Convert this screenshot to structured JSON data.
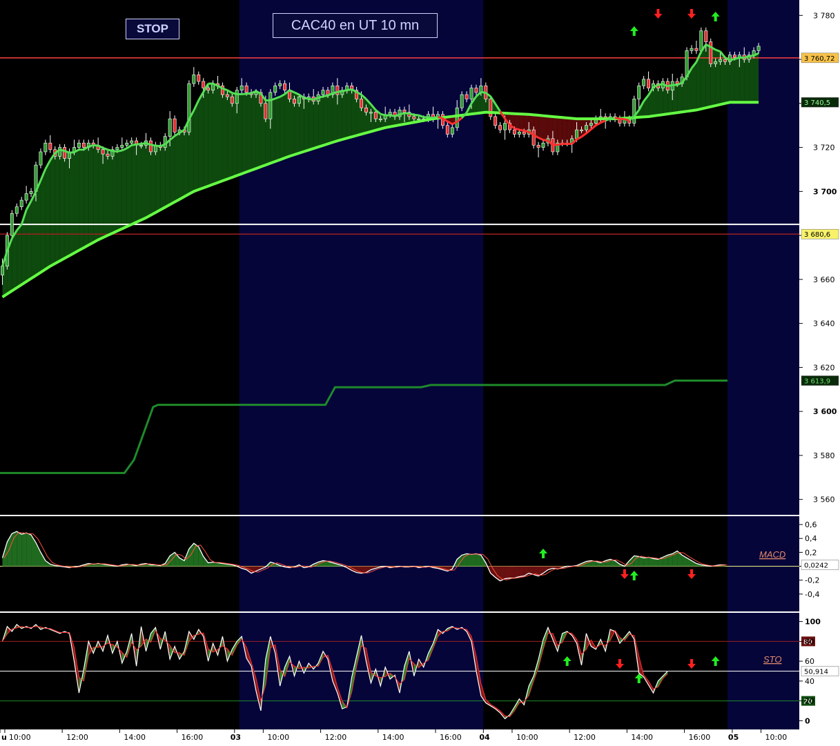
{
  "labels": {
    "stop": "STOP",
    "title": "CAC40 en UT 10 mn",
    "macd": "MACD",
    "sto": "STO"
  },
  "colors": {
    "background": "#000000",
    "session_band": "#05053a",
    "axis_bg": "#ffffff",
    "candle_up": "#2f9e2f",
    "candle_down": "#e23030",
    "ma_fast": "#55e055",
    "ma_slow": "#66ff44",
    "ma_red": "#ff3030",
    "fill_green": "#0e4a0e",
    "fill_red": "#5a0a0a",
    "stop_line": "#1f8a2a",
    "arrow_up": "#22ee22",
    "arrow_down": "#ff2020"
  },
  "chart_data": [
    {
      "type": "candlestick",
      "panel": "price",
      "y_ticks": [
        "3 780",
        "3 760",
        "3 740",
        "3 720",
        "3 700",
        "3 680",
        "3 660",
        "3 640",
        "3 620",
        "3 600",
        "3 580",
        "3 560"
      ],
      "y_ticks_bold": [
        "3 700",
        "3 600"
      ],
      "ylim": [
        3553,
        3787
      ],
      "x_ticks": [
        {
          "label": "u",
          "x": 0,
          "bold": true
        },
        {
          "label": "10:00",
          "x": 1
        },
        {
          "label": "12:00",
          "x": 13
        },
        {
          "label": "14:00",
          "x": 25
        },
        {
          "label": "16:00",
          "x": 37
        },
        {
          "label": "03",
          "x": 49,
          "bold": true
        },
        {
          "label": "10:00",
          "x": 55
        },
        {
          "label": "12:00",
          "x": 67
        },
        {
          "label": "14:00",
          "x": 79
        },
        {
          "label": "16:00",
          "x": 91
        },
        {
          "label": "04",
          "x": 101,
          "bold": true
        },
        {
          "label": "10:00",
          "x": 107
        },
        {
          "label": "12:00",
          "x": 119
        },
        {
          "label": "14:00",
          "x": 131
        },
        {
          "label": "16:00",
          "x": 143
        },
        {
          "label": "05",
          "x": 153,
          "bold": true
        },
        {
          "label": "10:00",
          "x": 159
        }
      ],
      "xlim": [
        0,
        167
      ],
      "sessions": [
        {
          "start": 0,
          "end": 50,
          "band": false
        },
        {
          "start": 50,
          "end": 101,
          "band": true
        },
        {
          "start": 101,
          "end": 152,
          "band": false
        },
        {
          "start": 152,
          "end": 167,
          "band": true
        }
      ],
      "closes": [
        3666,
        3680,
        3690,
        3693,
        3696,
        3699,
        3700,
        3712,
        3718,
        3722,
        3719,
        3716,
        3720,
        3715,
        3718,
        3720,
        3722,
        3720,
        3722,
        3721,
        3719,
        3717,
        3716,
        3719,
        3720,
        3721,
        3722,
        3723,
        3721,
        3721,
        3723,
        3718,
        3721,
        3720,
        3725,
        3733,
        3727,
        3728,
        3727,
        3749,
        3753,
        3750,
        3747,
        3746,
        3749,
        3748,
        3744,
        3743,
        3740,
        3746,
        3748,
        3745,
        3744,
        3745,
        3740,
        3733,
        3745,
        3748,
        3749,
        3746,
        3742,
        3740,
        3743,
        3742,
        3743,
        3741,
        3744,
        3746,
        3744,
        3748,
        3744,
        3746,
        3748,
        3746,
        3742,
        3738,
        3736,
        3736,
        3733,
        3733,
        3735,
        3736,
        3734,
        3737,
        3736,
        3734,
        3733,
        3733,
        3733,
        3735,
        3733,
        3735,
        3730,
        3726,
        3729,
        3738,
        3744,
        3742,
        3747,
        3745,
        3748,
        3742,
        3734,
        3730,
        3728,
        3731,
        3728,
        3726,
        3727,
        3726,
        3728,
        3721,
        3720,
        3722,
        3724,
        3718,
        3722,
        3722,
        3722,
        3724,
        3728,
        3728,
        3730,
        3731,
        3733,
        3734,
        3733,
        3734,
        3733,
        3731,
        3733,
        3731,
        3742,
        3748,
        3751,
        3747,
        3749,
        3747,
        3750,
        3746,
        3750,
        3749,
        3752,
        3764,
        3765,
        3764,
        3773,
        3768,
        3758,
        3759,
        3760,
        3759,
        3762,
        3761,
        3762,
        3760,
        3762,
        3764,
        3766
      ],
      "stop_level_label": "3 613,9",
      "stop_level": [
        {
          "x": 0,
          "y": 3572
        },
        {
          "x": 26,
          "y": 3572
        },
        {
          "x": 28,
          "y": 3578
        },
        {
          "x": 30,
          "y": 3590
        },
        {
          "x": 32,
          "y": 3602
        },
        {
          "x": 33,
          "y": 3603
        },
        {
          "x": 68,
          "y": 3603
        },
        {
          "x": 70,
          "y": 3611
        },
        {
          "x": 88,
          "y": 3611
        },
        {
          "x": 90,
          "y": 3612
        },
        {
          "x": 139,
          "y": 3612
        },
        {
          "x": 141,
          "y": 3614
        },
        {
          "x": 152,
          "y": 3614
        }
      ],
      "ma_slow_label": "3 740,5",
      "ma_slow": [
        {
          "x": 0,
          "y": 3652
        },
        {
          "x": 10,
          "y": 3666
        },
        {
          "x": 20,
          "y": 3678
        },
        {
          "x": 30,
          "y": 3688
        },
        {
          "x": 40,
          "y": 3700
        },
        {
          "x": 50,
          "y": 3708
        },
        {
          "x": 60,
          "y": 3716
        },
        {
          "x": 70,
          "y": 3723
        },
        {
          "x": 80,
          "y": 3729
        },
        {
          "x": 90,
          "y": 3733
        },
        {
          "x": 101,
          "y": 3736
        },
        {
          "x": 110,
          "y": 3735
        },
        {
          "x": 120,
          "y": 3733
        },
        {
          "x": 128,
          "y": 3733
        },
        {
          "x": 135,
          "y": 3734
        },
        {
          "x": 145,
          "y": 3737
        },
        {
          "x": 152,
          "y": 3740.5
        }
      ],
      "hlines": [
        {
          "label": "3 760,72",
          "y": 3760.7,
          "color": "#ff4040",
          "tag_bg": "#f7c24a",
          "tag_fg": "#000000"
        },
        {
          "label": "3 680,6",
          "y": 3680.6,
          "color": "#a02020",
          "tag_bg": "#f7f26a",
          "tag_fg": "#000000"
        },
        {
          "y": 3685,
          "color": "#ffffff"
        }
      ],
      "signals": [
        {
          "x": 132,
          "dir": "up"
        },
        {
          "x": 137,
          "dir": "down"
        },
        {
          "x": 144,
          "dir": "down"
        },
        {
          "x": 149,
          "dir": "up"
        }
      ]
    },
    {
      "type": "area",
      "panel": "macd",
      "name": "MACD",
      "value_label": "0,0242",
      "y_ticks": [
        "0,6",
        "0,4",
        "0,2",
        "0",
        "-0,2",
        "-0,4"
      ],
      "ylim": [
        -0.6,
        0.68
      ],
      "values": [
        0.12,
        0.35,
        0.47,
        0.5,
        0.46,
        0.48,
        0.45,
        0.34,
        0.2,
        0.08,
        0.03,
        0.01,
        0.0,
        -0.01,
        -0.02,
        -0.01,
        0.0,
        0.02,
        0.04,
        0.03,
        0.04,
        0.03,
        0.02,
        0.01,
        0.0,
        0.02,
        0.03,
        0.02,
        0.01,
        0.03,
        0.04,
        0.02,
        0.02,
        0.01,
        0.04,
        0.15,
        0.2,
        0.12,
        0.08,
        0.25,
        0.33,
        0.28,
        0.14,
        0.05,
        0.06,
        0.05,
        0.04,
        0.03,
        0.02,
        0.0,
        -0.03,
        -0.05,
        -0.1,
        -0.07,
        -0.04,
        -0.01,
        0.06,
        0.04,
        0.01,
        -0.01,
        -0.02,
        -0.01,
        0.02,
        -0.02,
        -0.01,
        0.03,
        0.06,
        0.08,
        0.07,
        0.05,
        0.03,
        0.01,
        -0.02,
        -0.06,
        -0.09,
        -0.1,
        -0.09,
        -0.05,
        -0.03,
        -0.01,
        0.0,
        -0.02,
        -0.01,
        0.0,
        -0.01,
        -0.01,
        0.0,
        -0.02,
        -0.01,
        0.0,
        -0.02,
        -0.03,
        -0.05,
        -0.07,
        -0.04,
        0.1,
        0.16,
        0.18,
        0.17,
        0.18,
        0.16,
        0.05,
        -0.1,
        -0.16,
        -0.21,
        -0.18,
        -0.17,
        -0.17,
        -0.15,
        -0.14,
        -0.1,
        -0.12,
        -0.14,
        -0.1,
        -0.05,
        -0.03,
        -0.04,
        -0.02,
        0.0,
        0.0,
        0.01,
        0.04,
        0.07,
        0.08,
        0.07,
        0.05,
        0.08,
        0.1,
        0.08,
        0.03,
        0.0,
        0.08,
        0.15,
        0.14,
        0.12,
        0.13,
        0.11,
        0.1,
        0.13,
        0.16,
        0.18,
        0.22,
        0.16,
        0.12,
        0.08,
        0.04,
        0.02,
        0.01,
        0.0,
        0.01,
        0.02,
        0.02
      ],
      "signals": [
        {
          "x": 113,
          "dir": "up"
        },
        {
          "x": 130,
          "dir": "down"
        },
        {
          "x": 132,
          "dir": "up"
        },
        {
          "x": 144,
          "dir": "down"
        }
      ]
    },
    {
      "type": "area",
      "panel": "sto",
      "name": "STO",
      "value_label": "50,914",
      "y_ticks": [
        "100",
        "80",
        "60",
        "40",
        "20",
        "0"
      ],
      "ylim": [
        -6,
        106
      ],
      "levels": [
        {
          "label": "80",
          "y": 80,
          "color": "#a02020"
        },
        {
          "label": "20",
          "y": 20,
          "color": "#1f8a2a"
        }
      ],
      "values": [
        80,
        95,
        90,
        97,
        93,
        95,
        93,
        97,
        92,
        94,
        92,
        90,
        88,
        90,
        88,
        60,
        28,
        52,
        80,
        68,
        80,
        70,
        86,
        68,
        80,
        58,
        70,
        88,
        55,
        95,
        70,
        88,
        94,
        72,
        90,
        62,
        75,
        62,
        70,
        90,
        82,
        92,
        85,
        60,
        78,
        66,
        85,
        60,
        72,
        80,
        85,
        63,
        55,
        30,
        10,
        62,
        85,
        68,
        35,
        54,
        65,
        45,
        60,
        48,
        58,
        52,
        58,
        70,
        62,
        40,
        28,
        12,
        14,
        44,
        65,
        86,
        60,
        38,
        52,
        35,
        54,
        42,
        46,
        28,
        55,
        70,
        45,
        62,
        54,
        68,
        78,
        92,
        88,
        93,
        95,
        92,
        94,
        90,
        80,
        50,
        25,
        18,
        15,
        12,
        8,
        2,
        6,
        14,
        22,
        16,
        35,
        45,
        62,
        82,
        94,
        82,
        70,
        88,
        90,
        86,
        78,
        56,
        88,
        75,
        72,
        82,
        70,
        92,
        90,
        78,
        84,
        90,
        82,
        48,
        44,
        36,
        28,
        40,
        45,
        50
      ],
      "signals": [
        {
          "x": 118,
          "dir": "up"
        },
        {
          "x": 129,
          "dir": "down"
        },
        {
          "x": 133,
          "dir": "up"
        },
        {
          "x": 144,
          "dir": "down"
        },
        {
          "x": 149,
          "dir": "up"
        }
      ]
    }
  ]
}
